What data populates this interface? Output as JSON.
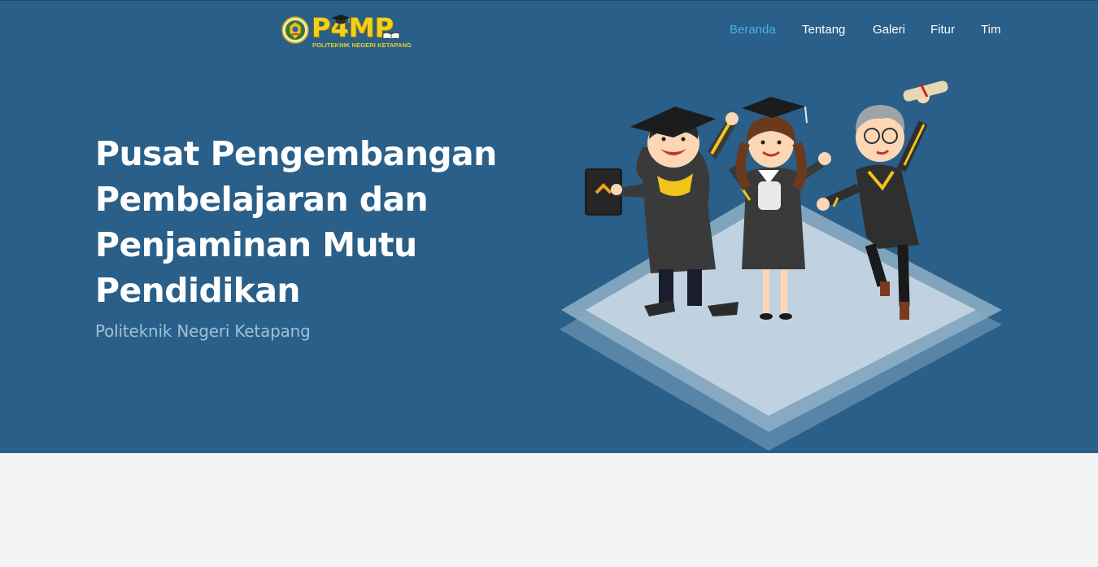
{
  "brand": {
    "name": "P4MP",
    "subtitle": "POLITEKNIK NEGERI KETAPANG",
    "emblem_icon": "campus-emblem-icon",
    "cap_icon": "graduation-cap-icon",
    "book_icon": "open-book-icon"
  },
  "nav": {
    "items": [
      {
        "label": "Beranda",
        "active": true
      },
      {
        "label": "Tentang",
        "active": false
      },
      {
        "label": "Galeri",
        "active": false
      },
      {
        "label": "Fitur",
        "active": false
      },
      {
        "label": "Tim",
        "active": false
      }
    ]
  },
  "hero": {
    "title": "Pusat Pengembangan Pembelajaran dan Penjaminan Mutu Pendidikan",
    "subtitle": "Politeknik Negeri Ketapang",
    "illustration": "graduates-illustration"
  },
  "colors": {
    "hero_bg": "#295f88",
    "nav_active": "#48b2e6",
    "logo_yellow": "#f2d11b",
    "page_bg": "#f3f4f3"
  }
}
